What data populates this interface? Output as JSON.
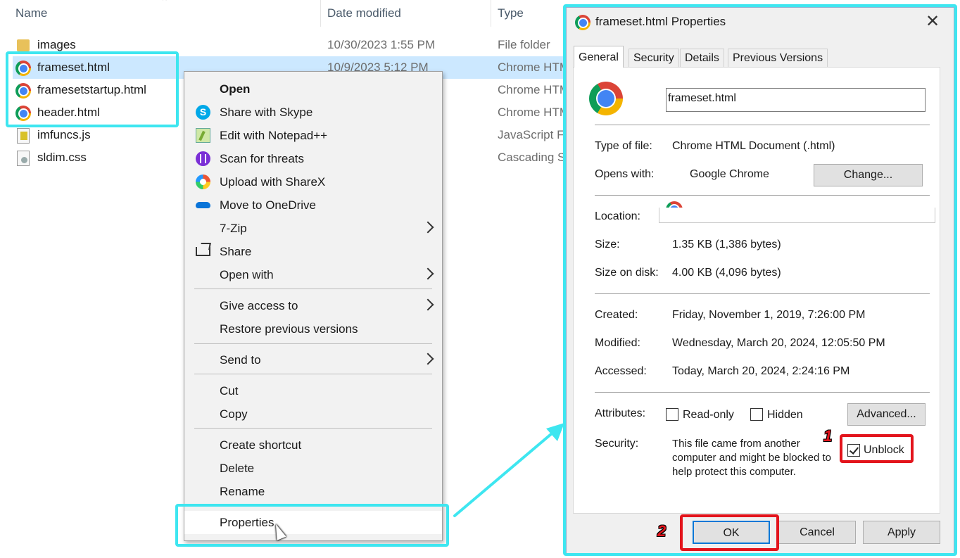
{
  "explorer": {
    "columns": {
      "name": "Name",
      "date": "Date modified",
      "type": "Type"
    },
    "files": [
      {
        "name": "images",
        "date": "10/30/2023 1:55 PM",
        "type": "File folder",
        "icon": "folder-icon"
      },
      {
        "name": "frameset.html",
        "date": "10/9/2023 5:12 PM",
        "type": "Chrome HTML",
        "icon": "chrome-icon",
        "selected": true
      },
      {
        "name": "framesetstartup.html",
        "date": "",
        "type": "Chrome HTML",
        "icon": "chrome-icon"
      },
      {
        "name": "header.html",
        "date": "",
        "type": "Chrome HTML",
        "icon": "chrome-icon"
      },
      {
        "name": "imfuncs.js",
        "date": "",
        "type": "JavaScript F",
        "icon": "js-file-icon"
      },
      {
        "name": "sldim.css",
        "date": "",
        "type": "Cascading S",
        "icon": "css-file-icon"
      }
    ]
  },
  "context_menu": {
    "items": [
      {
        "label": "Open",
        "bold": true
      },
      {
        "label": "Share with Skype",
        "icon": "skype-icon"
      },
      {
        "label": "Edit with Notepad++",
        "icon": "notepadpp-icon"
      },
      {
        "label": "Scan for threats",
        "icon": "scan-threats-icon"
      },
      {
        "label": "Upload with ShareX",
        "icon": "sharex-icon"
      },
      {
        "label": "Move to OneDrive",
        "icon": "onedrive-icon"
      },
      {
        "label": "7-Zip",
        "submenu": true
      },
      {
        "label": "Share",
        "icon": "share-icon"
      },
      {
        "label": "Open with",
        "submenu": true
      },
      {
        "label": "Give access to",
        "submenu": true
      },
      {
        "label": "Restore previous versions"
      },
      {
        "label": "Send to",
        "submenu": true
      },
      {
        "label": "Cut"
      },
      {
        "label": "Copy"
      },
      {
        "label": "Create shortcut"
      },
      {
        "label": "Delete"
      },
      {
        "label": "Rename"
      },
      {
        "label": "Properties"
      }
    ]
  },
  "dialog": {
    "title": "frameset.html Properties",
    "close_glyph": "✕",
    "tabs": [
      "General",
      "Security",
      "Details",
      "Previous Versions"
    ],
    "filename": "frameset.html",
    "type_label": "Type of file:",
    "type_value": "Chrome HTML Document (.html)",
    "opens_label": "Opens with:",
    "opens_value": "Google Chrome",
    "change_button": "Change...",
    "location_label": "Location:",
    "location_value": "",
    "size_label": "Size:",
    "size_value": "1.35 KB (1,386 bytes)",
    "disk_label": "Size on disk:",
    "disk_value": "4.00 KB (4,096 bytes)",
    "created_label": "Created:",
    "created_value": "Friday, November 1, 2019, 7:26:00 PM",
    "modified_label": "Modified:",
    "modified_value": "Wednesday, March 20, 2024, 12:05:50 PM",
    "accessed_label": "Accessed:",
    "accessed_value": "Today, March 20, 2024, 2:24:16 PM",
    "attributes_label": "Attributes:",
    "readonly_label": "Read-only",
    "hidden_label": "Hidden",
    "advanced_button": "Advanced...",
    "security_label": "Security:",
    "security_line1": "This file came from another",
    "security_line2": "computer and might be blocked to",
    "security_line3": "help protect this computer.",
    "unblock_label": "Unblock",
    "unblock_checked": true,
    "ok_button": "OK",
    "cancel_button": "Cancel",
    "apply_button": "Apply"
  },
  "annotations": {
    "step1": "1",
    "step2": "2",
    "highlight_color": "#3ee6f0",
    "step_color": "#e3141c"
  }
}
